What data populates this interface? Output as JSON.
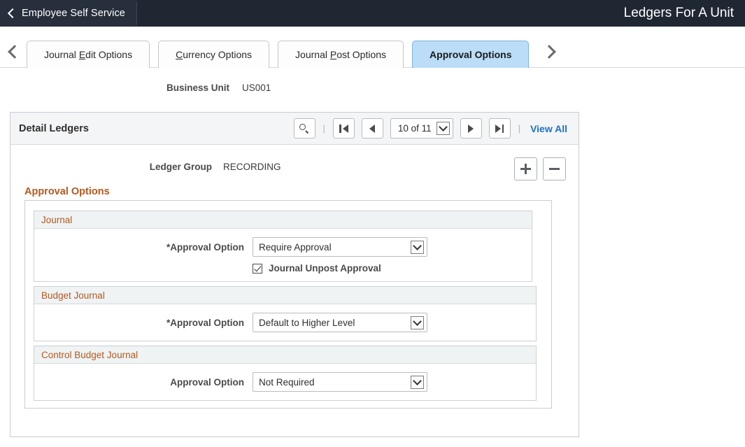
{
  "header": {
    "back_label": "Employee Self Service",
    "back_icon": "chevron-left-icon",
    "title": "Ledgers For A Unit"
  },
  "tabs": {
    "prev_icon": "chevron-left-icon",
    "next_icon": "chevron-right-icon",
    "items": [
      {
        "label": "Journal Edit Options",
        "accel": "E",
        "pre": "Journal ",
        "post": "dit Options",
        "active": false
      },
      {
        "label": "Currency Options",
        "accel": "C",
        "pre": "",
        "post": "urrency Options",
        "active": false
      },
      {
        "label": "Journal Post Options",
        "accel": "P",
        "pre": "Journal ",
        "post": "ost Options",
        "active": false
      },
      {
        "label": "Approval Options",
        "accel": "",
        "pre": "Approval Options",
        "post": "",
        "active": true
      }
    ]
  },
  "business_unit": {
    "label": "Business Unit",
    "value": "US001"
  },
  "grid": {
    "title": "Detail Ledgers",
    "search_icon": "search-icon",
    "first_icon": "first-page-icon",
    "prev_icon": "previous-page-icon",
    "next_icon": "next-page-icon",
    "last_icon": "last-page-icon",
    "pager_value": "10 of 11",
    "view_all_label": "View All",
    "separator": "|",
    "add_icon": "plus-icon",
    "remove_icon": "minus-icon"
  },
  "row": {
    "ledger_group_label": "Ledger Group",
    "ledger_group_value": "RECORDING"
  },
  "approval": {
    "section_title": "Approval Options",
    "groups": [
      {
        "name": "Journal",
        "field_label": "*Approval Option",
        "field_value": "Require Approval",
        "checkbox": {
          "label": "Journal Unpost Approval",
          "checked": true
        }
      },
      {
        "name": "Budget Journal",
        "field_label": "*Approval Option",
        "field_value": "Default to Higher Level"
      },
      {
        "name": "Control Budget Journal",
        "field_label": "Approval Option",
        "field_value": "Not Required"
      }
    ]
  },
  "colors": {
    "header_bg": "#1f2733",
    "active_tab_bg": "#bbddf7",
    "section_heading": "#b4591e",
    "link": "#1a73c8"
  }
}
